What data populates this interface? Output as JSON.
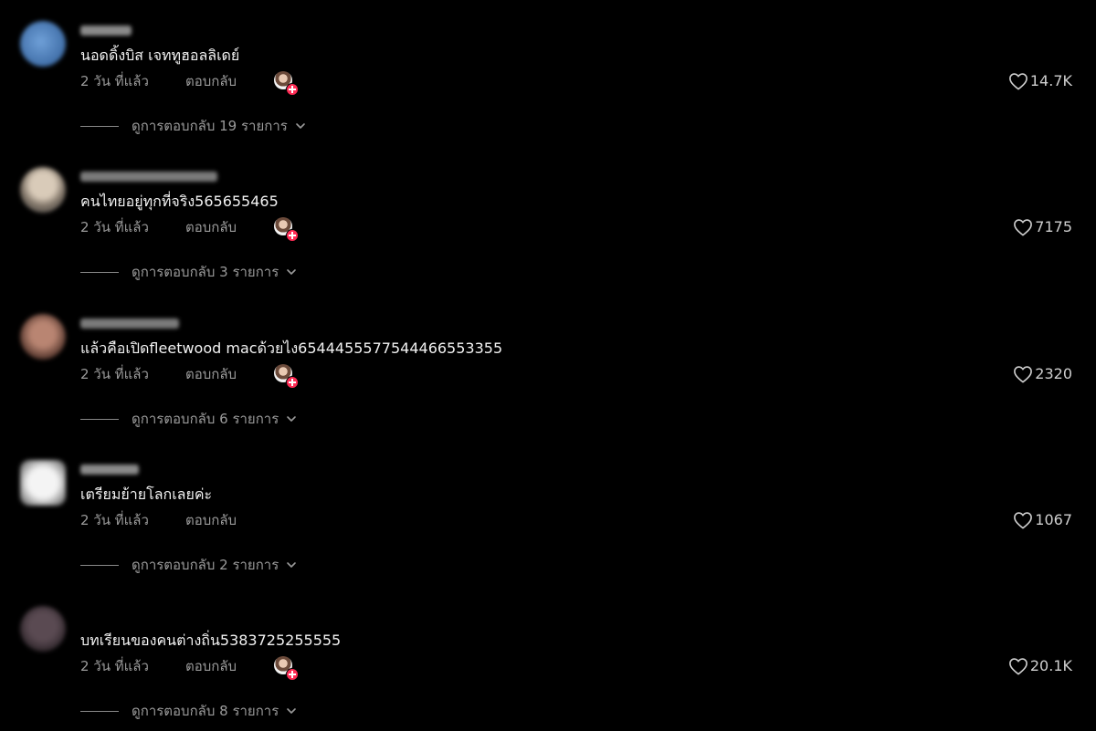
{
  "comments": [
    {
      "text": "นอดดิ้งบิส เจททูฮอลลิเดย์",
      "time": "2 วัน ที่แล้ว",
      "reply_label": "ตอบกลับ",
      "likes": "14.7K",
      "view_replies": "ดูการตอบกลับ 19 รายการ"
    },
    {
      "text": "คนไทยอยู่ทุกที่จริง565655465",
      "time": "2 วัน ที่แล้ว",
      "reply_label": "ตอบกลับ",
      "likes": "7175",
      "view_replies": "ดูการตอบกลับ 3 รายการ"
    },
    {
      "text": "แล้วคือเปิดfleetwood macด้วยไง6544455577544466553355",
      "time": "2 วัน ที่แล้ว",
      "reply_label": "ตอบกลับ",
      "likes": "2320",
      "view_replies": "ดูการตอบกลับ 6 รายการ"
    },
    {
      "text": "เตรียมย้ายโลกเลยค่ะ",
      "time": "2 วัน ที่แล้ว",
      "reply_label": "ตอบกลับ",
      "likes": "1067",
      "view_replies": "ดูการตอบกลับ 2 รายการ"
    },
    {
      "text": "บทเรียนของคนต่างถิ่น5383725255555",
      "time": "2 วัน ที่แล้ว",
      "reply_label": "ตอบกลับ",
      "likes": "20.1K",
      "view_replies": "ดูการตอบกลับ 8 รายการ"
    }
  ],
  "colors": {
    "background": "#000000",
    "primary_text": "#f2f2f2",
    "secondary_text": "#9a9a9a",
    "creator_badge": "#fe2c55"
  },
  "icons": {
    "like": "heart-outline-icon",
    "expand": "chevron-down-icon",
    "creator_badge": "plus-badge-icon"
  }
}
